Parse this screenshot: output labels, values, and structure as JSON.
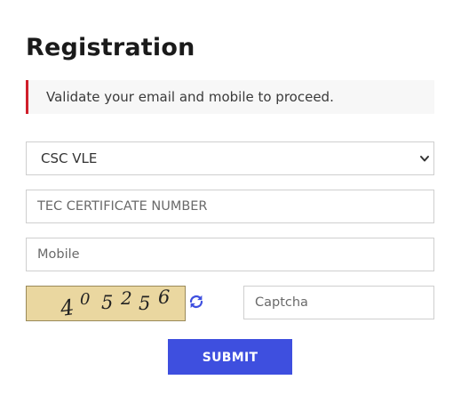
{
  "page": {
    "title": "Registration",
    "notice": "Validate your email and mobile to proceed."
  },
  "form": {
    "user_type": {
      "selected": "CSC VLE"
    },
    "tec_certificate": {
      "placeholder": "TEC CERTIFICATE NUMBER",
      "value": ""
    },
    "mobile": {
      "placeholder": "Mobile",
      "value": ""
    },
    "captcha": {
      "image_text": [
        "4",
        "0",
        "5",
        "2",
        "5",
        "6"
      ],
      "placeholder": "Captcha",
      "value": "",
      "refresh_icon": "refresh-icon"
    },
    "submit_label": "SUBMIT"
  },
  "colors": {
    "accent": "#3e4fdf",
    "notice_border": "#d01f2b",
    "captcha_background": "#ead7a0"
  }
}
